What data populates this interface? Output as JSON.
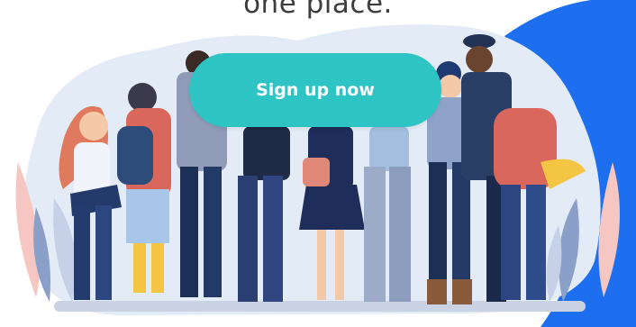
{
  "hero": {
    "heading": "one place.",
    "cta_label": "Sign up now",
    "illustration_name": "people-group-illustration"
  },
  "colors": {
    "accent_blue": "#1e6ff0",
    "button_teal": "#2ec4c4",
    "blob_bg": "#e3ecf6",
    "text": "#3d3d3d"
  }
}
